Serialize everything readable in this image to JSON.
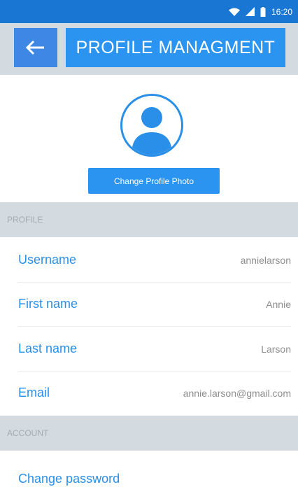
{
  "status_bar": {
    "time": "16:20",
    "icons": [
      "wifi-icon",
      "signal-icon",
      "battery-icon"
    ]
  },
  "header": {
    "back_icon": "arrow-left-icon",
    "title": "PROFILE MANAGMENT"
  },
  "avatar": {
    "icon": "user-avatar-icon"
  },
  "change_photo": {
    "label": "Change Profile Photo"
  },
  "sections": {
    "profile": "PROFILE",
    "account": "ACCOUNT"
  },
  "profile_fields": {
    "username": {
      "label": "Username",
      "value": "annielarson"
    },
    "first_name": {
      "label": "First name",
      "value": "Annie"
    },
    "last_name": {
      "label": "Last name",
      "value": "Larson"
    },
    "email": {
      "label": "Email",
      "value": "annie.larson@gmail.com"
    }
  },
  "account": {
    "change_password": "Change password"
  },
  "colors": {
    "status_bar": "#1976d2",
    "header_bg": "#d3dae0",
    "back_button": "#3f87e4",
    "title_bg": "#2a94f0",
    "accent": "#2a8fe8",
    "value_text": "#8e8e8e",
    "section_text": "#a3adb6"
  }
}
